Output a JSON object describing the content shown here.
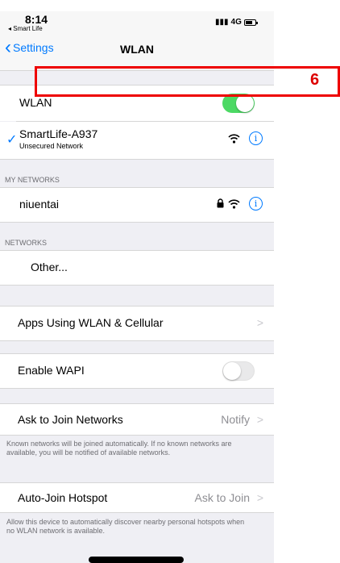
{
  "status_bar": {
    "time": "8:14",
    "back_app": "◂ Smart Life",
    "carrier": "4G"
  },
  "nav": {
    "back_label": "Settings",
    "title": "WLAN"
  },
  "wlan_toggle": {
    "label": "WLAN",
    "on": true
  },
  "connected_network": {
    "name": "SmartLife-A937",
    "subtitle": "Unsecured Network",
    "check": "✓"
  },
  "my_networks": {
    "header": "MY NETWORKS",
    "items": [
      {
        "name": "niuentai",
        "secured": true
      }
    ]
  },
  "networks": {
    "header": "NETWORKS",
    "other_label": "Other..."
  },
  "apps_using": {
    "label": "Apps Using WLAN & Cellular"
  },
  "wapi": {
    "label": "Enable WAPI",
    "on": false
  },
  "ask_to_join": {
    "label": "Ask to Join Networks",
    "value": "Notify",
    "footer": "Known networks will be joined automatically. If no known networks are available, you will be notified of available networks."
  },
  "auto_join": {
    "label": "Auto-Join Hotspot",
    "value": "Ask to Join",
    "footer": "Allow this device to automatically discover nearby personal hotspots when no WLAN network is available."
  },
  "annotation": {
    "number": "6",
    "color": "#e00000"
  },
  "colors": {
    "accent": "#007aff",
    "toggle_on": "#4cd964",
    "background": "#efeff4"
  },
  "icons": [
    "chevron-left-icon",
    "wifi-icon",
    "info-icon",
    "lock-icon",
    "checkmark-icon",
    "chevron-right-icon",
    "battery-icon"
  ]
}
